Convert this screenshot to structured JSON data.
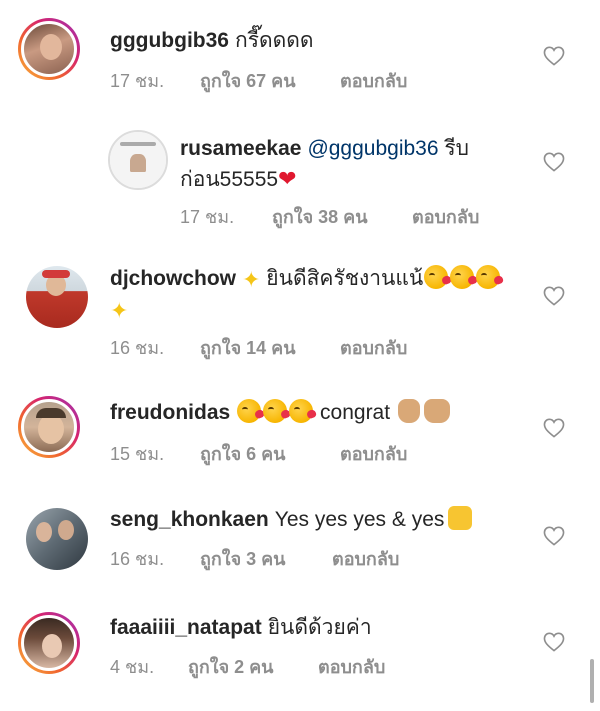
{
  "comments": [
    {
      "username": "gggubgib36",
      "text": "กรี๊ดดดด",
      "time": "17 ชม.",
      "likes": "ถูกใจ 67 คน",
      "reply": "ตอบกลับ",
      "avatar": "woman-portrait"
    },
    {
      "username": "rusameekae",
      "mention": "@gggubgib36",
      "text_line1": "รีบ",
      "text_line2": "ก่อน55555",
      "emoji": "❤",
      "time": "17 ชม.",
      "likes": "ถูกใจ 38 คน",
      "reply": "ตอบกลับ",
      "avatar": "brand-logo"
    },
    {
      "username": "djchowchow",
      "text": "ยินดีสิครัชงานแน้",
      "time": "16 ชม.",
      "likes": "ถูกใจ 14 คน",
      "reply": "ตอบกลับ",
      "avatar": "man-red-shirt"
    },
    {
      "username": "freudonidas",
      "text": "congrat",
      "time": "15 ชม.",
      "likes": "ถูกใจ 6 คน",
      "reply": "ตอบกลับ",
      "avatar": "man-portrait"
    },
    {
      "username": "seng_khonkaen",
      "text": "Yes yes yes & yes",
      "time": "16 ชม.",
      "likes": "ถูกใจ 3 คน",
      "reply": "ตอบกลับ",
      "avatar": "two-men"
    },
    {
      "username": "faaaiiii_natapat",
      "text": "ยินดีด้วยค่า",
      "time": "4 ชม.",
      "likes": "ถูกใจ 2 คน",
      "reply": "ตอบกลับ",
      "avatar": "woman-hair"
    }
  ],
  "colors": {
    "text": "#262626",
    "meta": "#8e8e8e",
    "mention": "#003569",
    "story_ring_start": "#f9b640",
    "story_ring_end": "#9b36b7"
  }
}
